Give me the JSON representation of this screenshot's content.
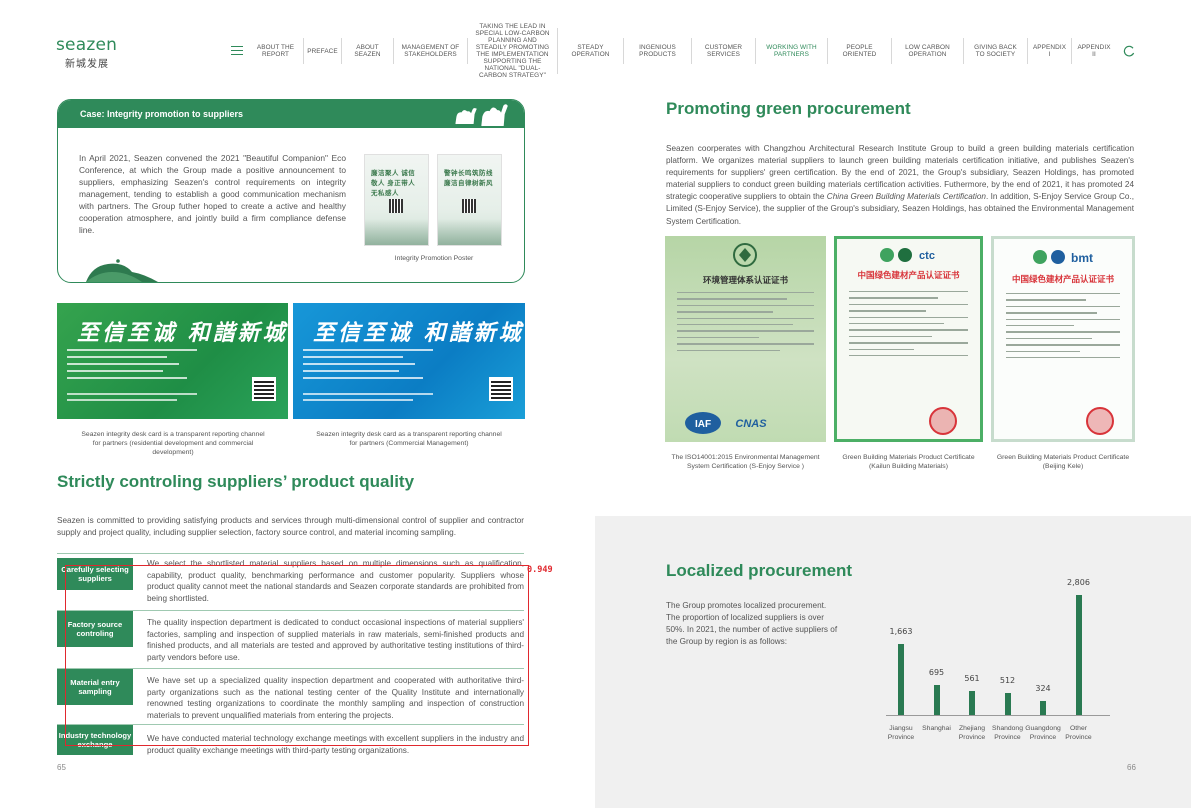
{
  "header": {
    "logo_en": "seazen",
    "logo_cn": "新城发展",
    "nav": [
      {
        "label": "ABOUT THE REPORT",
        "active": false
      },
      {
        "label": "PREFACE",
        "active": false
      },
      {
        "label": "ABOUT SEAZEN",
        "active": false
      },
      {
        "label": "MANAGEMENT OF STAKEHOLDERS",
        "active": false
      },
      {
        "label": "TAKING THE LEAD IN SPECIAL LOW-CARBON PLANNING AND STEADILY PROMOTING THE IMPLEMENTATION SUPPORTING THE NATIONAL \"DUAL-CARBON STRATEGY\"",
        "active": false
      },
      {
        "label": "STEADY OPERATION",
        "active": false
      },
      {
        "label": "INGENIOUS PRODUCTS",
        "active": false
      },
      {
        "label": "CUSTOMER SERVICES",
        "active": false
      },
      {
        "label": "WORKING WITH PARTNERS",
        "active": true
      },
      {
        "label": "PEOPLE ORIENTED",
        "active": false
      },
      {
        "label": "LOW CARBON OPERATION",
        "active": false
      },
      {
        "label": "GIVING BACK TO SOCIETY",
        "active": false
      },
      {
        "label": "APPENDIX I",
        "active": false
      },
      {
        "label": "APPENDIX II",
        "active": false
      }
    ]
  },
  "case": {
    "title": "Case: Integrity promotion to suppliers",
    "text": "In April 2021, Seazen convened the 2021 \"Beautiful Companion\" Eco Conference, at which the Group made a positive announcement to suppliers, emphasizing Seazen's control requirements on integrity management, tending to establish a good communication mechanism with partners. The Group futher hoped to create a active and healthy cooperation atmosphere, and jointly build a firm compliance defense line.",
    "poster_caption": "Integrity Promotion Poster",
    "poster1_text": "廉洁聚人 诚信敬人 身正带人 无私感人",
    "poster2_text": "警钟长鸣筑防线 廉洁自律树新风"
  },
  "desk_cards": [
    {
      "calligraphy": "至信至诚 和諧新城",
      "caption": "Seazen integrity desk card is a transparent reporting channel for partners (residential development and commercial development)"
    },
    {
      "calligraphy": "至信至诚 和諧新城",
      "caption": "Seazen integrity desk card as a transparent reporting channel for partners (Commercial Management)"
    }
  ],
  "quality": {
    "title": "Strictly controling suppliers’ product quality",
    "intro": "Seazen is committed to providing satisfying products and services through multi-dimensional control of supplier and contractor supply and project quality, including supplier selection, factory source control, and material incoming sampling.",
    "rows": [
      {
        "label": "Carefully selecting suppliers",
        "text": "We select the shortlisted material suppliers based on multiple dimensions such as qualification, capability, product quality, benchmarking performance and customer popularity. Suppliers whose product quality cannot meet the national standards and Seazen corporate standards are prohibited from being shortlisted."
      },
      {
        "label": "Factory source controling",
        "text": "The quality inspection department is dedicated to conduct occasional inspections of material suppliers' factories, sampling and inspection of supplied materials in raw materials, semi-finished products and finished products, and all materials are tested and approved by authoritative testing institutions of third-party vendors before use."
      },
      {
        "label": "Material entry sampling",
        "text": "We have set up a specialized quality inspection department and cooperated with authoritative third-party organizations such as the national testing center of the Quality Institute and internationally renowned testing organizations to coordinate the monthly sampling and inspection of construction materials to prevent unqualified materials from entering the projects."
      },
      {
        "label": "Industry technology exchange",
        "text": "We have conducted material technology exchange meetings with excellent suppliers in the industry and product quality exchange meetings with third-party testing organizations."
      }
    ],
    "detection_score": "0.949"
  },
  "green": {
    "title": "Promoting green procurement",
    "text_before": "Seazen coorperates with Changzhou Architectural Research Institute Group to build a green building materials certification platform. We organizes material suppliers to launch green building materials certification initiative, and publishes Seazen's requirements for suppliers' green certification. By the end of 2021, the Group's subsidiary, Seazen Holdings, has promoted material suppliers to conduct green building materials certification activities. Futhermore, by the end of 2021, it has promoted 24 strategic cooperative suppliers to obtain the ",
    "text_italic": "China Green Building Materials Certification",
    "text_after": ". In addition, S-Enjoy Service Group Co., Limited (S-Enjoy Service), the supplier of the Group's subsidiary, Seazen Holdings, has obtained the Environmental Management System Certification.",
    "certificates": [
      {
        "title": "环境管理体系认证证书",
        "caption": "The ISO14001:2015 Environmental Management System Certification (S-Enjoy Service )"
      },
      {
        "title": "中国绿色建材产品认证证书",
        "caption": "Green Building Materials Product Certificate (Kailun Building Materials)"
      },
      {
        "title": "中国绿色建材产品认证证书",
        "caption": "Green Building Materials Product Certificate (Beijing Kele)"
      }
    ],
    "cert_brand_2": "ctc",
    "cert_brand_3": "bmt",
    "cert_logos_1": [
      "IAF",
      "CNAS"
    ]
  },
  "localized": {
    "title": "Localized procurement",
    "text": "The Group promotes localized procurement. The proportion of localized suppliers is over 50%. In 2021, the number of active suppliers of the Group by region is as follows:"
  },
  "chart_data": {
    "type": "bar",
    "categories": [
      "Jiangsu Province",
      "Shanghai",
      "Zhejiang Province",
      "Shandong Province",
      "Guangdong Province",
      "Other Province"
    ],
    "values": [
      1663,
      695,
      561,
      512,
      324,
      2806
    ],
    "value_labels": [
      "1,663",
      "695",
      "561",
      "512",
      "324",
      "2,806"
    ],
    "ylim": [
      0,
      2806
    ],
    "grid": false,
    "bar_color": "#2a7a52"
  },
  "pages": {
    "left": "65",
    "right": "66"
  },
  "colors": {
    "brand_green": "#2f8a5a",
    "highlight_red": "#e0282e"
  }
}
